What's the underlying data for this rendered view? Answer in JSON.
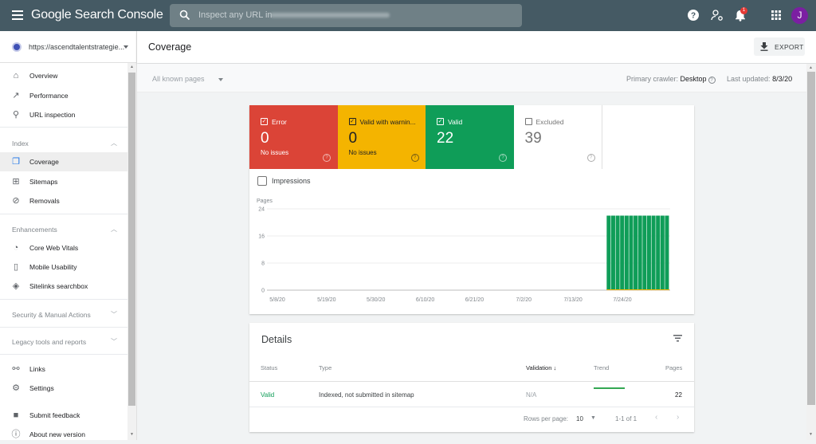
{
  "app": {
    "title_google": "Google",
    "title_product": "Search Console",
    "search_placeholder": "Inspect any URL in",
    "notification_count": "1",
    "avatar_initial": "J",
    "icons": [
      "menu-icon",
      "search-icon",
      "help-icon",
      "manage-users-icon",
      "notifications-icon",
      "apps-grid-icon"
    ]
  },
  "sidebar": {
    "property": "https://ascendtalentstrategie...",
    "items": [
      {
        "label": "Overview",
        "icon": "home-icon",
        "glyph": "⌂"
      },
      {
        "label": "Performance",
        "icon": "trending-icon",
        "glyph": "↗"
      },
      {
        "label": "URL inspection",
        "icon": "search-icon",
        "glyph": "⚲"
      }
    ],
    "index_section": {
      "label": "Index",
      "expanded": true,
      "items": [
        {
          "label": "Coverage",
          "icon": "coverage-icon",
          "glyph": "❐",
          "active": true
        },
        {
          "label": "Sitemaps",
          "icon": "sitemap-icon",
          "glyph": "⊞"
        },
        {
          "label": "Removals",
          "icon": "removals-icon",
          "glyph": "⊘"
        }
      ]
    },
    "enhancements_section": {
      "label": "Enhancements",
      "expanded": true,
      "items": [
        {
          "label": "Core Web Vitals",
          "icon": "gauge-icon",
          "glyph": "◔"
        },
        {
          "label": "Mobile Usability",
          "icon": "phone-icon",
          "glyph": "▯"
        },
        {
          "label": "Sitelinks searchbox",
          "icon": "layers-icon",
          "glyph": "◈"
        }
      ]
    },
    "security_section": {
      "label": "Security & Manual Actions",
      "expanded": false
    },
    "legacy_section": {
      "label": "Legacy tools and reports",
      "expanded": false
    },
    "bottom_items": [
      {
        "label": "Links",
        "icon": "links-icon",
        "glyph": "⚯"
      },
      {
        "label": "Settings",
        "icon": "settings-icon",
        "glyph": "⚙"
      },
      {
        "label": "Submit feedback",
        "icon": "feedback-icon",
        "glyph": "■"
      },
      {
        "label": "About new version",
        "icon": "info-icon",
        "glyph": "ⓘ"
      }
    ]
  },
  "header": {
    "title": "Coverage",
    "export_label": "EXPORT"
  },
  "filter": {
    "pages_filter": "All known pages",
    "crawler_label": "Primary crawler:",
    "crawler_value": "Desktop",
    "updated_label": "Last updated:",
    "updated_value": "8/3/20"
  },
  "tiles": [
    {
      "label": "Error",
      "value": "0",
      "sub": "No issues",
      "checked": true,
      "bg": "#db4437",
      "fg": "#ffffff"
    },
    {
      "label": "Valid with warnin...",
      "value": "0",
      "sub": "No issues",
      "checked": true,
      "bg": "#f4b400",
      "fg": "#202124"
    },
    {
      "label": "Valid",
      "value": "22",
      "sub": "",
      "checked": true,
      "bg": "#0f9d58",
      "fg": "#ffffff"
    },
    {
      "label": "Excluded",
      "value": "39",
      "sub": "",
      "checked": false,
      "bg": "#ffffff",
      "fg": "#757575"
    }
  ],
  "impressions_label": "Impressions",
  "chart_data": {
    "type": "bar",
    "ylabel": "Pages",
    "ylim": [
      0,
      24
    ],
    "yticks": [
      0,
      8,
      16,
      24
    ],
    "grid": true,
    "xticks": [
      "5/8/20",
      "5/19/20",
      "5/30/20",
      "6/10/20",
      "6/21/20",
      "7/2/20",
      "7/13/20",
      "7/24/20"
    ],
    "x_start": "5/8/20",
    "x_end": "8/3/20",
    "series": [
      {
        "name": "Valid",
        "color": "#0f9d58",
        "dates": [
          "7/21/20",
          "7/22/20",
          "7/23/20",
          "7/24/20",
          "7/25/20",
          "7/26/20",
          "7/27/20",
          "7/28/20",
          "7/29/20",
          "7/30/20",
          "7/31/20",
          "8/1/20",
          "8/2/20",
          "8/3/20"
        ],
        "values": [
          22,
          22,
          22,
          22,
          22,
          22,
          22,
          22,
          22,
          22,
          22,
          22,
          22,
          22
        ]
      },
      {
        "name": "Valid with warnings",
        "color": "#f4b400",
        "dates": [
          "7/21/20",
          "8/3/20"
        ],
        "values": [
          0,
          0
        ]
      },
      {
        "name": "Error",
        "color": "#db4437",
        "dates": [
          "7/21/20",
          "8/3/20"
        ],
        "values": [
          0,
          0
        ]
      }
    ]
  },
  "details": {
    "title": "Details",
    "columns": [
      "Status",
      "Type",
      "Validation",
      "Trend",
      "Pages"
    ],
    "rows": [
      {
        "status": "Valid",
        "type": "Indexed, not submitted in sitemap",
        "validation": "N/A",
        "pages": "22"
      }
    ],
    "rows_per_page_label": "Rows per page:",
    "rows_per_page": "10",
    "range": "1-1 of 1",
    "status_color": "#0f9d58"
  }
}
